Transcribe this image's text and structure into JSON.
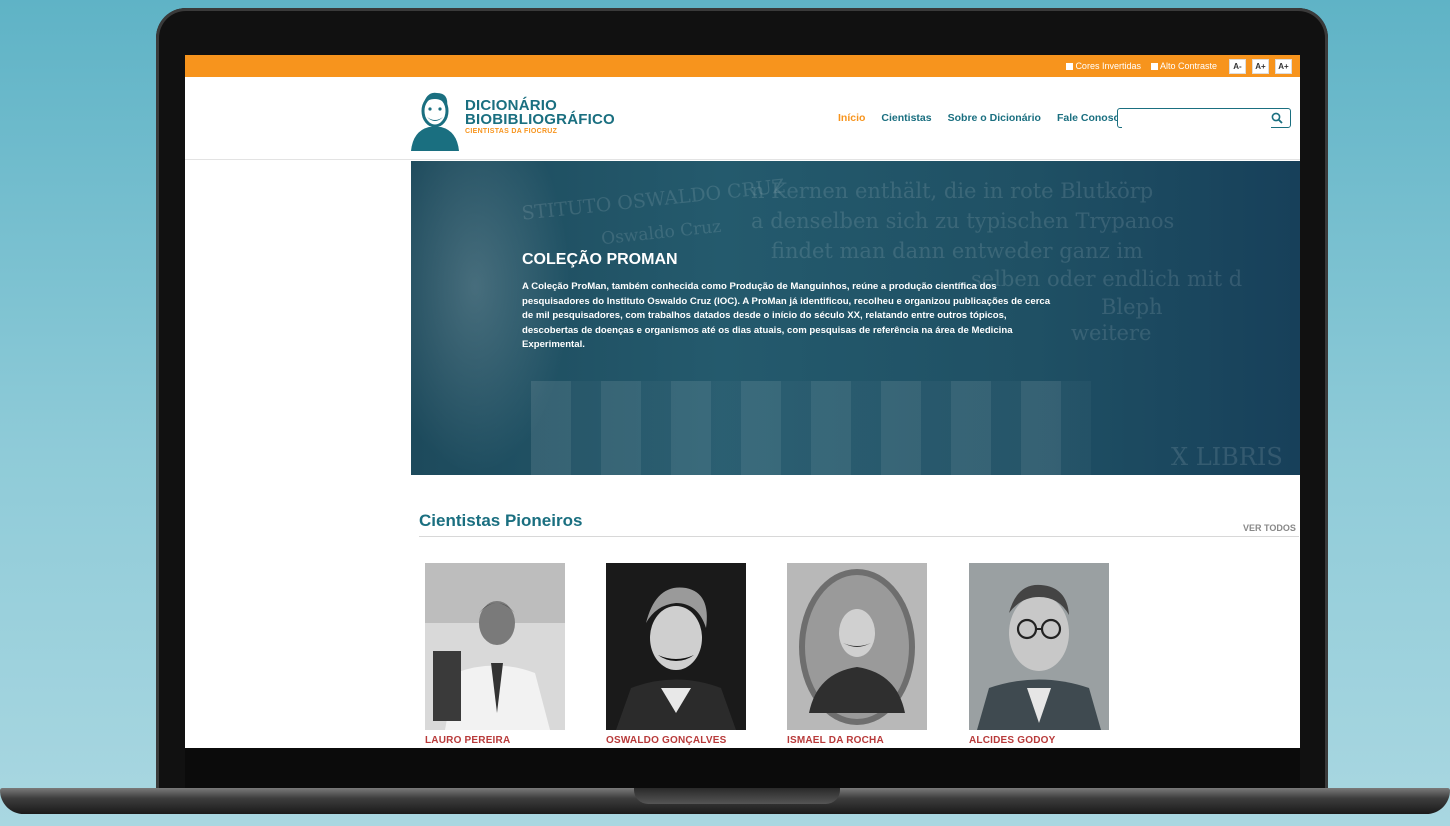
{
  "topbar": {
    "inverted_colors": "Cores Invertidas",
    "high_contrast": "Alto Contraste",
    "font_buttons": [
      "A-",
      "A+",
      "A+"
    ]
  },
  "logo": {
    "line1": "DICIONÁRIO",
    "line2": "BIOBIBLIOGRÁFICO",
    "sub": "CIENTISTAS DA FIOCRUZ"
  },
  "nav": {
    "items": [
      "Início",
      "Cientistas",
      "Sobre o Dicionário",
      "Fale Conosco"
    ]
  },
  "search": {
    "placeholder": ""
  },
  "hero": {
    "title": "COLEÇÃO PROMAN",
    "text": "A Coleção ProMan, também conhecida como Produção de Manguinhos, reúne a produção científica dos pesquisadores do Instituto Oswaldo Cruz (IOC). A ProMan já identificou, recolheu e organizou publicações de cerca de mil pesquisadores, com trabalhos datados desde o início do século XX, relatando entre outros tópicos, descobertas de doenças e organismos até os dias atuais, com pesquisas de referência na área de Medicina Experimental.",
    "background_text": [
      "STITUTO OSWALDO CRUZ",
      "Oswaldo Cruz",
      "n Kernen enthält, die in rote Blutkörp",
      "a denselben sich zu typischen Trypanos",
      "findet man dann entweder ganz im",
      "selben oder endlich mit d",
      "Bleph",
      "weitere",
      "X LIBRIS"
    ]
  },
  "section": {
    "title": "Cientistas Pioneiros",
    "see_all": "VER TODOS"
  },
  "scientists": [
    {
      "name": "LAURO PEREIRA"
    },
    {
      "name": "OSWALDO GONÇALVES"
    },
    {
      "name": "ISMAEL DA ROCHA"
    },
    {
      "name": "ALCIDES GODOY"
    }
  ],
  "colors": {
    "accent_orange": "#f7941d",
    "brand_teal": "#1a6f80",
    "name_red": "#b83a3a"
  }
}
